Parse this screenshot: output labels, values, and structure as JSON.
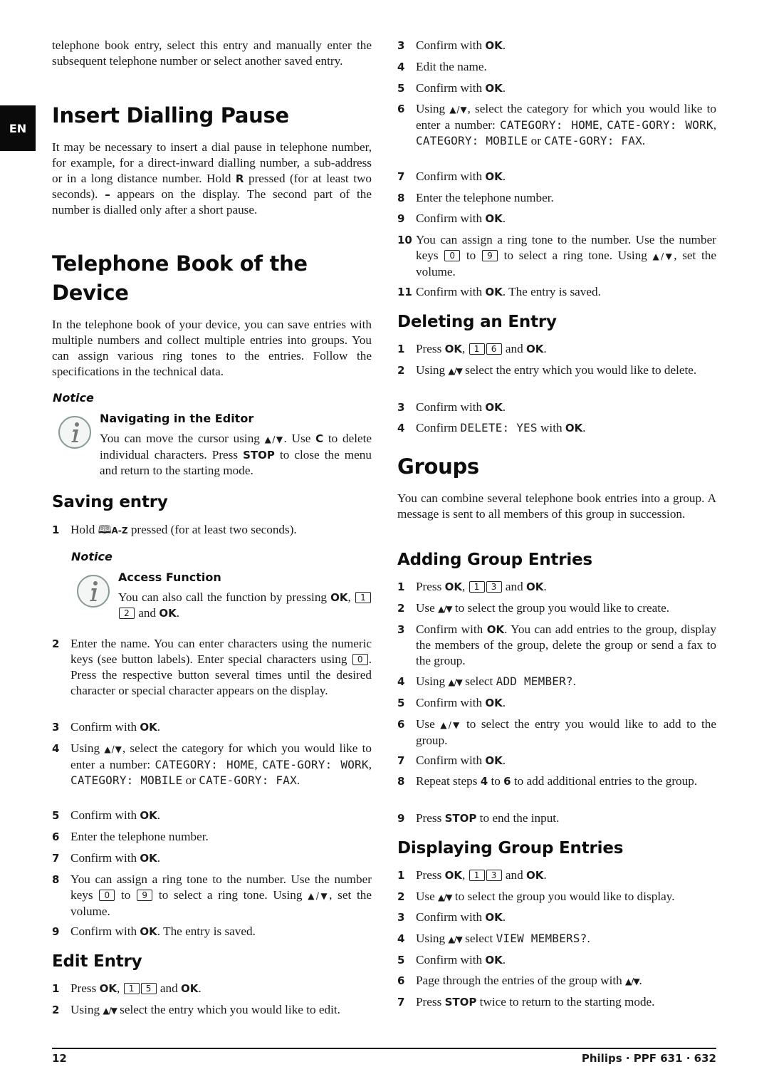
{
  "language_tab": "EN",
  "left": {
    "intro": [
      {
        "t": "telephone book entry, select this entry and manually enter the subsequent telephone number or select another saved entry."
      }
    ],
    "insert_pause": {
      "title": "Insert Dialling Pause",
      "body": [
        {
          "t": "It may be necessary to insert a dial pause in telephone number, for example, for a direct-inward dialling number, a sub-address or in a long distance number. Hold "
        },
        {
          "b": "R"
        },
        {
          "t": " pressed (for at least two seconds). "
        },
        {
          "b": "–"
        },
        {
          "t": " appears on the display. The second part of the number is dialled only after a short pause."
        }
      ]
    },
    "phonebook": {
      "title": "Telephone Book of the Device",
      "body": [
        {
          "t": "In the telephone book of your device, you can save entries with multiple numbers and collect multiple entries into groups. You can assign various ring tones to the entries. Follow the specifications in the technical data."
        }
      ],
      "notice": {
        "label": "Notice",
        "title": "Navigating in the Editor",
        "body": [
          {
            "t": "You can move the cursor using "
          },
          {
            "arrows": "▲/▼"
          },
          {
            "t": ". Use "
          },
          {
            "b": "C"
          },
          {
            "t": " to delete individual characters. Press "
          },
          {
            "b": "STOP"
          },
          {
            "t": " to close the menu and return to the starting mode."
          }
        ]
      }
    },
    "saving": {
      "title": "Saving entry",
      "step1": {
        "n": "1",
        "parts": [
          {
            "t": "Hold "
          },
          {
            "book": "🕮"
          },
          {
            "booklabel": "A-Z"
          },
          {
            "t": " pressed (for at least two seconds)."
          }
        ]
      },
      "notice": {
        "label": "Notice",
        "title": "Access Function",
        "body": [
          {
            "t": "You can also call the function by pressing "
          },
          {
            "b": "OK"
          },
          {
            "t": ", "
          },
          {
            "key": "1"
          },
          {
            "key": "2"
          },
          {
            "t": " and "
          },
          {
            "b": "OK"
          },
          {
            "t": "."
          }
        ]
      },
      "steps": [
        {
          "n": "2",
          "parts": [
            {
              "t": "Enter the name. You can enter characters using the numeric keys (see button labels).  Enter special charac­ters using "
            },
            {
              "key": "0"
            },
            {
              "t": ". Press the respective button several times until the desired character or special character appears on the display."
            }
          ]
        },
        {
          "n": "3",
          "parts": [
            {
              "t": "Confirm with "
            },
            {
              "b": "OK"
            },
            {
              "t": "."
            }
          ]
        },
        {
          "n": "4",
          "parts": [
            {
              "t": "Using "
            },
            {
              "arrows": "▲/▼"
            },
            {
              "t": ", select the category for which you would like to enter a number: "
            },
            {
              "lcd": "CATEGORY:  HOME"
            },
            {
              "t": ", "
            },
            {
              "lcd": "CATE-GORY:  WORK"
            },
            {
              "t": ", "
            },
            {
              "lcd": "CATEGORY:  MOBILE"
            },
            {
              "t": " or "
            },
            {
              "lcd": "CATE-GORY:  FAX"
            },
            {
              "t": "."
            }
          ]
        },
        {
          "n": "5",
          "parts": [
            {
              "t": "Confirm with "
            },
            {
              "b": "OK"
            },
            {
              "t": "."
            }
          ]
        },
        {
          "n": "6",
          "parts": [
            {
              "t": "Enter the telephone number."
            }
          ]
        },
        {
          "n": "7",
          "parts": [
            {
              "t": "Confirm with "
            },
            {
              "b": "OK"
            },
            {
              "t": "."
            }
          ]
        },
        {
          "n": "8",
          "parts": [
            {
              "t": "You can assign a ring tone to the number. Use the number keys "
            },
            {
              "key": "0"
            },
            {
              "t": " to "
            },
            {
              "key": "9"
            },
            {
              "t": " to select a ring tone. Using "
            },
            {
              "arrows": "▲/▼"
            },
            {
              "t": ", set the volume."
            }
          ]
        },
        {
          "n": "9",
          "parts": [
            {
              "t": "Confirm with "
            },
            {
              "b": "OK"
            },
            {
              "t": ". The entry is saved."
            }
          ]
        }
      ]
    },
    "edit": {
      "title": "Edit Entry",
      "steps": [
        {
          "n": "1",
          "parts": [
            {
              "t": "Press "
            },
            {
              "b": "OK"
            },
            {
              "t": ", "
            },
            {
              "key": "1"
            },
            {
              "key": "5"
            },
            {
              "t": " and "
            },
            {
              "b": "OK"
            },
            {
              "t": "."
            }
          ]
        },
        {
          "n": "2",
          "parts": [
            {
              "t": "Using "
            },
            {
              "arrows": "▲/▼"
            },
            {
              "t": " select the entry which you would like to edit."
            }
          ]
        }
      ]
    }
  },
  "right": {
    "edit_cont": [
      {
        "n": "3",
        "parts": [
          {
            "t": "Confirm with "
          },
          {
            "b": "OK"
          },
          {
            "t": "."
          }
        ]
      },
      {
        "n": "4",
        "parts": [
          {
            "t": "Edit the name."
          }
        ]
      },
      {
        "n": "5",
        "parts": [
          {
            "t": "Confirm with "
          },
          {
            "b": "OK"
          },
          {
            "t": "."
          }
        ]
      },
      {
        "n": "6",
        "parts": [
          {
            "t": "Using "
          },
          {
            "arrows": "▲/▼"
          },
          {
            "t": ", select the category for which you would like to enter a number: "
          },
          {
            "lcd": "CATEGORY:  HOME"
          },
          {
            "t": ", "
          },
          {
            "lcd": "CATE-GORY:  WORK"
          },
          {
            "t": ", "
          },
          {
            "lcd": "CATEGORY:  MOBILE"
          },
          {
            "t": " or "
          },
          {
            "lcd": "CATE-GORY:  FAX"
          },
          {
            "t": "."
          }
        ]
      },
      {
        "n": "7",
        "parts": [
          {
            "t": "Confirm with "
          },
          {
            "b": "OK"
          },
          {
            "t": "."
          }
        ]
      },
      {
        "n": "8",
        "parts": [
          {
            "t": "Enter the telephone number."
          }
        ]
      },
      {
        "n": "9",
        "parts": [
          {
            "t": "Confirm with "
          },
          {
            "b": "OK"
          },
          {
            "t": "."
          }
        ]
      },
      {
        "n": "10",
        "parts": [
          {
            "t": "You can assign a ring tone to the number. Use the number keys "
          },
          {
            "key": "0"
          },
          {
            "t": " to "
          },
          {
            "key": "9"
          },
          {
            "t": " to select a ring tone. Using "
          },
          {
            "arrows": "▲/▼"
          },
          {
            "t": ", set the volume."
          }
        ]
      },
      {
        "n": "11",
        "parts": [
          {
            "t": "Confirm with "
          },
          {
            "b": "OK"
          },
          {
            "t": ". The entry is saved."
          }
        ]
      }
    ],
    "deleting": {
      "title": "Deleting an Entry",
      "steps": [
        {
          "n": "1",
          "parts": [
            {
              "t": "Press "
            },
            {
              "b": "OK"
            },
            {
              "t": ", "
            },
            {
              "key": "1"
            },
            {
              "key": "6"
            },
            {
              "t": " and "
            },
            {
              "b": "OK"
            },
            {
              "t": "."
            }
          ]
        },
        {
          "n": "2",
          "parts": [
            {
              "t": "Using "
            },
            {
              "arrows": "▲/▼"
            },
            {
              "t": " select the entry which you would like to delete."
            }
          ]
        },
        {
          "n": "3",
          "parts": [
            {
              "t": "Confirm with "
            },
            {
              "b": "OK"
            },
            {
              "t": "."
            }
          ]
        },
        {
          "n": "4",
          "parts": [
            {
              "t": "Confirm "
            },
            {
              "lcd": "DELETE:  YES"
            },
            {
              "t": " with "
            },
            {
              "b": "OK"
            },
            {
              "t": "."
            }
          ]
        }
      ]
    },
    "groups": {
      "title": "Groups",
      "body": [
        {
          "t": "You can combine several telephone book entries into a group. A message is sent to all members of this group in succession."
        }
      ]
    },
    "adding": {
      "title": "Adding Group Entries",
      "steps": [
        {
          "n": "1",
          "parts": [
            {
              "t": "Press "
            },
            {
              "b": "OK"
            },
            {
              "t": ", "
            },
            {
              "key": "1"
            },
            {
              "key": "3"
            },
            {
              "t": " and "
            },
            {
              "b": "OK"
            },
            {
              "t": "."
            }
          ]
        },
        {
          "n": "2",
          "parts": [
            {
              "t": "Use "
            },
            {
              "arrows": "▲/▼"
            },
            {
              "t": " to select the group you would like to create."
            }
          ]
        },
        {
          "n": "3",
          "parts": [
            {
              "t": "Confirm with "
            },
            {
              "b": "OK"
            },
            {
              "t": ". You can add entries to the group, display the members of the group, delete the group or send a fax to the group."
            }
          ]
        },
        {
          "n": "4",
          "parts": [
            {
              "t": "Using "
            },
            {
              "arrows": "▲/▼"
            },
            {
              "t": " select "
            },
            {
              "lcd": "ADD MEMBER?"
            },
            {
              "t": "."
            }
          ]
        },
        {
          "n": "5",
          "parts": [
            {
              "t": "Confirm with "
            },
            {
              "b": "OK"
            },
            {
              "t": "."
            }
          ]
        },
        {
          "n": "6",
          "parts": [
            {
              "t": "Use "
            },
            {
              "arrows": "▲/▼"
            },
            {
              "t": " to select the entry you would like to add to the group."
            }
          ]
        },
        {
          "n": "7",
          "parts": [
            {
              "t": "Confirm with "
            },
            {
              "b": "OK"
            },
            {
              "t": "."
            }
          ]
        },
        {
          "n": "8",
          "parts": [
            {
              "t": "Repeat steps "
            },
            {
              "b": "4"
            },
            {
              "t": " to "
            },
            {
              "b": "6"
            },
            {
              "t": " to add additional entries to the group."
            }
          ]
        },
        {
          "n": "9",
          "parts": [
            {
              "t": "Press "
            },
            {
              "b": "STOP"
            },
            {
              "t": " to end the input."
            }
          ]
        }
      ]
    },
    "displaying": {
      "title": "Displaying Group Entries",
      "steps": [
        {
          "n": "1",
          "parts": [
            {
              "t": "Press "
            },
            {
              "b": "OK"
            },
            {
              "t": ", "
            },
            {
              "key": "1"
            },
            {
              "key": "3"
            },
            {
              "t": " and "
            },
            {
              "b": "OK"
            },
            {
              "t": "."
            }
          ]
        },
        {
          "n": "2",
          "parts": [
            {
              "t": "Use "
            },
            {
              "arrows": "▲/▼"
            },
            {
              "t": " to select the group you would like to display."
            }
          ]
        },
        {
          "n": "3",
          "parts": [
            {
              "t": "Confirm with "
            },
            {
              "b": "OK"
            },
            {
              "t": "."
            }
          ]
        },
        {
          "n": "4",
          "parts": [
            {
              "t": "Using "
            },
            {
              "arrows": "▲/▼"
            },
            {
              "t": " select "
            },
            {
              "lcd": "VIEW MEMBERS?"
            },
            {
              "t": "."
            }
          ]
        },
        {
          "n": "5",
          "parts": [
            {
              "t": "Confirm with "
            },
            {
              "b": "OK"
            },
            {
              "t": "."
            }
          ]
        },
        {
          "n": "6",
          "parts": [
            {
              "t": "Page through the entries of the group with "
            },
            {
              "arrows": "▲/▼"
            },
            {
              "t": "."
            }
          ]
        },
        {
          "n": "7",
          "parts": [
            {
              "t": "Press "
            },
            {
              "b": "STOP"
            },
            {
              "t": " twice to return to the starting mode."
            }
          ]
        }
      ]
    }
  },
  "footer": {
    "page_number": "12",
    "brand": "Philips · PPF 631 · 632"
  }
}
